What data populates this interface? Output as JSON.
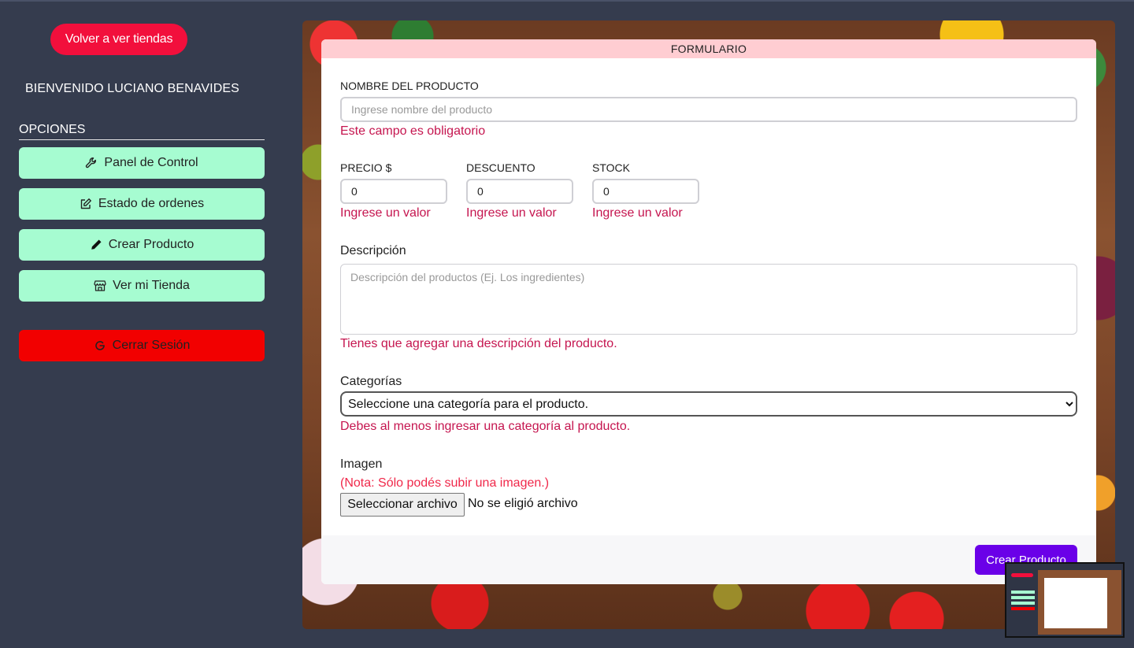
{
  "sidebar": {
    "back_button": "Volver a ver tiendas",
    "welcome": "BIENVENIDO LUCIANO BENAVIDES",
    "options_title": "OPCIONES",
    "items": [
      {
        "label": "Panel de Control",
        "icon": "wrench-icon"
      },
      {
        "label": "Estado de ordenes",
        "icon": "edit-icon"
      },
      {
        "label": "Crear Producto",
        "icon": "pencil-icon"
      },
      {
        "label": "Ver mi Tienda",
        "icon": "store-icon"
      }
    ],
    "logout": {
      "label": "Cerrar Sesión",
      "icon": "google-icon"
    }
  },
  "form": {
    "header": "FORMULARIO",
    "name": {
      "label": "NOMBRE DEL PRODUCTO",
      "placeholder": "Ingrese nombre del producto",
      "value": "",
      "error": "Este campo es obligatorio"
    },
    "price": {
      "label": "PRECIO $",
      "value": "0",
      "error": "Ingrese un valor"
    },
    "discount": {
      "label": "DESCUENTO",
      "value": "0",
      "error": "Ingrese un valor"
    },
    "stock": {
      "label": "STOCK",
      "value": "0",
      "error": "Ingrese un valor"
    },
    "description": {
      "label": "Descripción",
      "placeholder": "Descripción del productos (Ej. Los ingredientes)",
      "error": "Tienes que agregar una descripción del producto."
    },
    "categories": {
      "label": "Categorías",
      "selected": "Seleccione una categoría para el producto.",
      "error": "Debes al menos ingresar una categoría al producto."
    },
    "image": {
      "label": "Imagen",
      "note": "(Nota: Sólo podés subir una imagen.)",
      "button": "Seleccionar archivo",
      "status": "No se eligió archivo"
    },
    "submit": "Crear Producto"
  },
  "colors": {
    "background": "#353c4e",
    "accent_red": "#f20f3c",
    "sidebar_button": "#a6fcd1",
    "logout": "#f20000",
    "header": "#ffcdd2",
    "error": "#c5154f",
    "submit": "#6a00e8"
  }
}
